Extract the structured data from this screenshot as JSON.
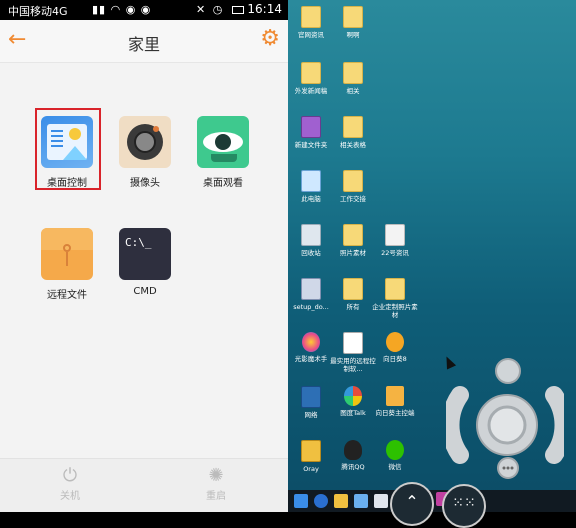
{
  "status_bar": {
    "carrier": "中国移动4G",
    "time": "16:14"
  },
  "header": {
    "title": "家里"
  },
  "tiles": [
    {
      "label": "桌面控制",
      "icon": "desktop-control-icon"
    },
    {
      "label": "摄像头",
      "icon": "camera-icon"
    },
    {
      "label": "桌面观看",
      "icon": "eye-icon"
    },
    {
      "label": "远程文件",
      "icon": "file-envelope-icon"
    },
    {
      "label": "CMD",
      "icon": "terminal-icon",
      "glyph": "C:\\_"
    }
  ],
  "bottom": {
    "shutdown": "关机",
    "restart": "重启"
  },
  "desktop_icons": [
    {
      "label": "官网资讯"
    },
    {
      "label": "啊啊"
    },
    {
      "label": "外发新闻稿"
    },
    {
      "label": "相关"
    },
    {
      "label": "新建文件夹"
    },
    {
      "label": "相关表格"
    },
    {
      "label": "此电脑"
    },
    {
      "label": "工作交接"
    },
    {
      "label": "回收站"
    },
    {
      "label": "照片素材"
    },
    {
      "label": "22号资讯"
    },
    {
      "label": "setup_do..."
    },
    {
      "label": "所有"
    },
    {
      "label": "企业定制照片素材"
    },
    {
      "label": "光影魔术手"
    },
    {
      "label": "最实用的远程控制软..."
    },
    {
      "label": "向日葵8"
    },
    {
      "label": "网络"
    },
    {
      "label": "图度Talk"
    },
    {
      "label": "向日葵主控端"
    },
    {
      "label": "Oray"
    },
    {
      "label": "腾讯QQ"
    },
    {
      "label": "微信"
    }
  ],
  "colors": {
    "accent": "#f08a32",
    "highlight": "#d9232a"
  }
}
